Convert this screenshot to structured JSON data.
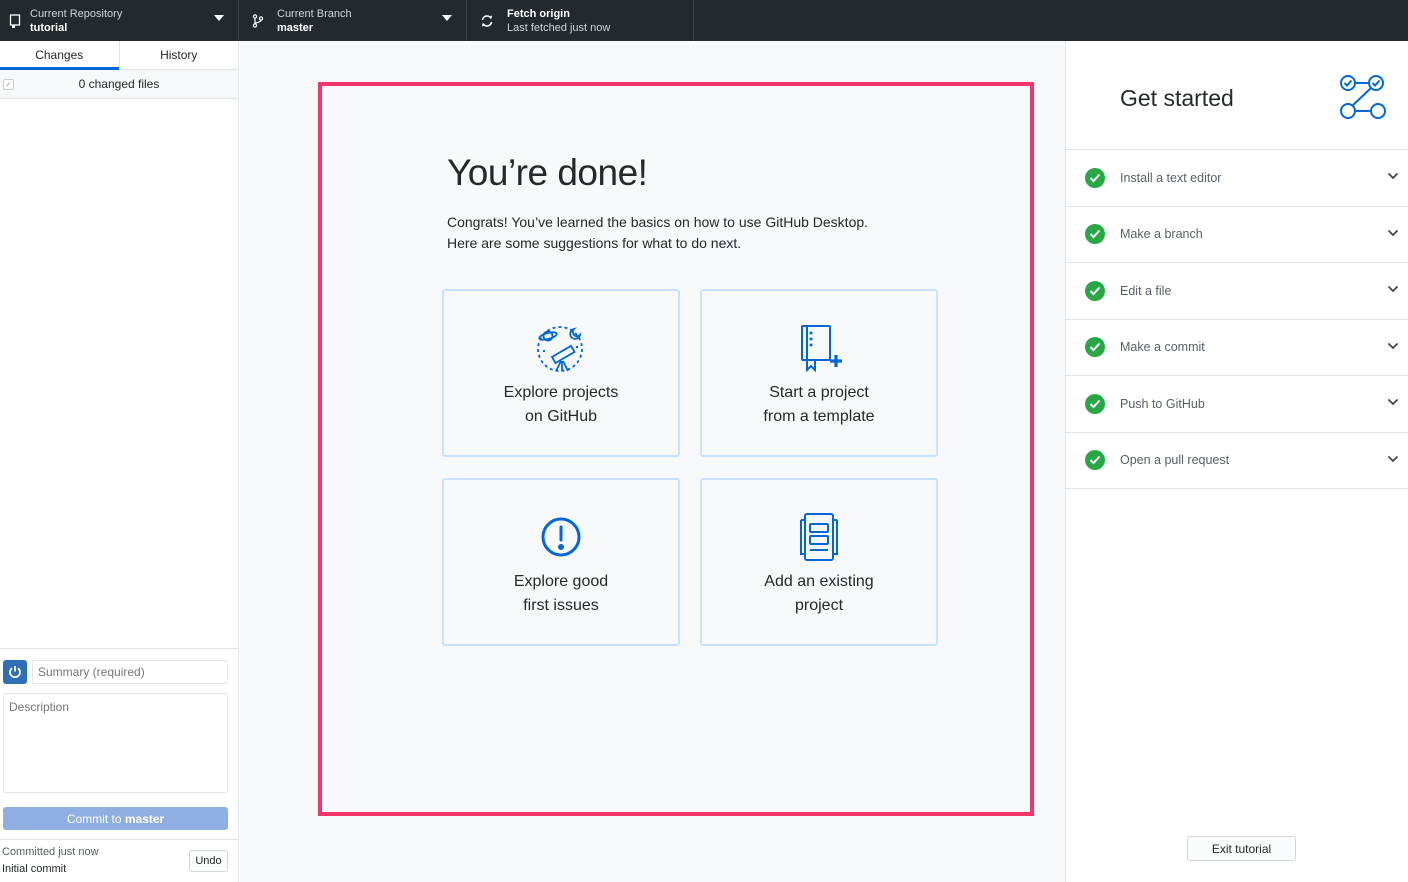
{
  "toolbar": {
    "repository": {
      "label": "Current Repository",
      "value": "tutorial",
      "icon": "repo-icon"
    },
    "branch": {
      "label": "Current Branch",
      "value": "master",
      "icon": "branch-icon"
    },
    "fetch": {
      "label": "Fetch origin",
      "value": "Last fetched just now",
      "icon": "sync-icon"
    }
  },
  "sidebar": {
    "tabs": [
      {
        "label": "Changes",
        "active": true
      },
      {
        "label": "History",
        "active": false
      }
    ],
    "changed_files": "0 changed files",
    "summary_placeholder": "Summary (required)",
    "description_placeholder": "Description",
    "commit_button_prefix": "Commit to ",
    "commit_button_branch": "master",
    "last_commit": {
      "status": "Committed just now",
      "message": "Initial commit",
      "undo_label": "Undo"
    }
  },
  "main": {
    "title": "You’re done!",
    "text_line1": "Congrats! You’ve learned the basics on how to use GitHub Desktop.",
    "text_line2": "Here are some suggestions for what to do next.",
    "cards": [
      {
        "line1": "Explore projects",
        "line2": "on GitHub",
        "icon": "telescope-icon"
      },
      {
        "line1": "Start a project",
        "line2": "from a template",
        "icon": "template-icon"
      },
      {
        "line1": "Explore good",
        "line2": "first issues",
        "icon": "issue-icon"
      },
      {
        "line1": "Add an existing",
        "line2": "project",
        "icon": "repo-add-icon"
      }
    ],
    "highlight_color": "#f5336d"
  },
  "right": {
    "title": "Get started",
    "steps": [
      {
        "label": "Install a text editor",
        "done": true
      },
      {
        "label": "Make a branch",
        "done": true
      },
      {
        "label": "Edit a file",
        "done": true
      },
      {
        "label": "Make a commit",
        "done": true
      },
      {
        "label": "Push to GitHub",
        "done": true
      },
      {
        "label": "Open a pull request",
        "done": true
      }
    ],
    "exit_label": "Exit tutorial"
  },
  "colors": {
    "toolbar_bg": "#24292e",
    "accent": "#0366d6",
    "success": "#28a745",
    "card_border": "#c8e1ff",
    "commit_button": "#8fafe3"
  }
}
